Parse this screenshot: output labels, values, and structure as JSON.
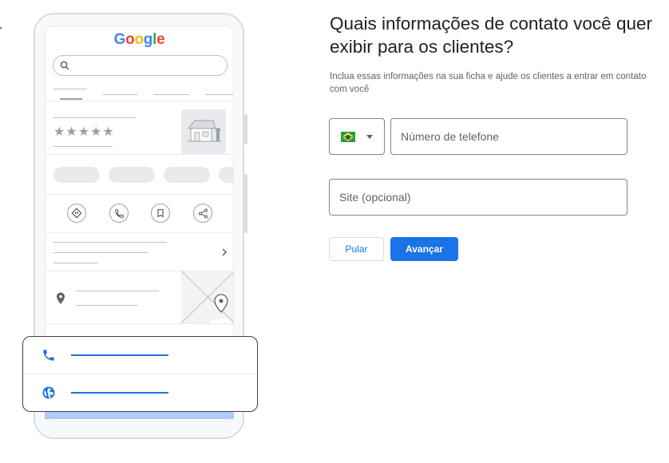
{
  "illustration": {
    "logo_letters": [
      {
        "ch": "G",
        "color": "#4285F4"
      },
      {
        "ch": "o",
        "color": "#EA4335"
      },
      {
        "ch": "o",
        "color": "#FBBC05"
      },
      {
        "ch": "g",
        "color": "#4285F4"
      },
      {
        "ch": "l",
        "color": "#34A853"
      },
      {
        "ch": "e",
        "color": "#EA4335"
      }
    ],
    "stars": "★★★★★",
    "icons": [
      "search-icon",
      "directions-icon",
      "phone-icon",
      "bookmark-icon",
      "share-icon",
      "chevron-right-icon",
      "location-pin-icon",
      "phone-icon",
      "globe-icon"
    ]
  },
  "form": {
    "title": "Quais informações de contato você quer exibir para os clientes?",
    "subtitle": "Inclua essas informações na sua ficha e ajude os clientes a entrar em contato com você",
    "country_flag": "brazil-flag",
    "phone_placeholder": "Número de telefone",
    "site_placeholder": "Site (opcional)",
    "skip_label": "Pular",
    "next_label": "Avançar"
  },
  "colors": {
    "primary": "#1a73e8",
    "text": "#202124",
    "secondary_text": "#5f6368"
  }
}
